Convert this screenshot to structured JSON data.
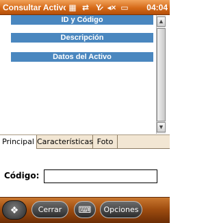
{
  "titlebar": {
    "title": "Consultar Activo",
    "clock": "04:04",
    "icons": [
      "start-menu-icon",
      "connectivity-icon",
      "no-signal-icon",
      "speaker-muted-icon",
      "battery-icon"
    ]
  },
  "sections": [
    "ID y Código",
    "Descripción",
    "Datos del Activo"
  ],
  "tabs": [
    "Principal",
    "Características",
    "Foto"
  ],
  "form": {
    "codigo_label": "Código:",
    "codigo_value": ""
  },
  "bottombar": {
    "left_button": "Cerrar",
    "right_button": "Opciones"
  },
  "colors": {
    "titlebar": "#d66a18",
    "section_header": "#4a87bf",
    "tabs_bg": "#f2e6d3",
    "bottombar": "#a04e10"
  }
}
